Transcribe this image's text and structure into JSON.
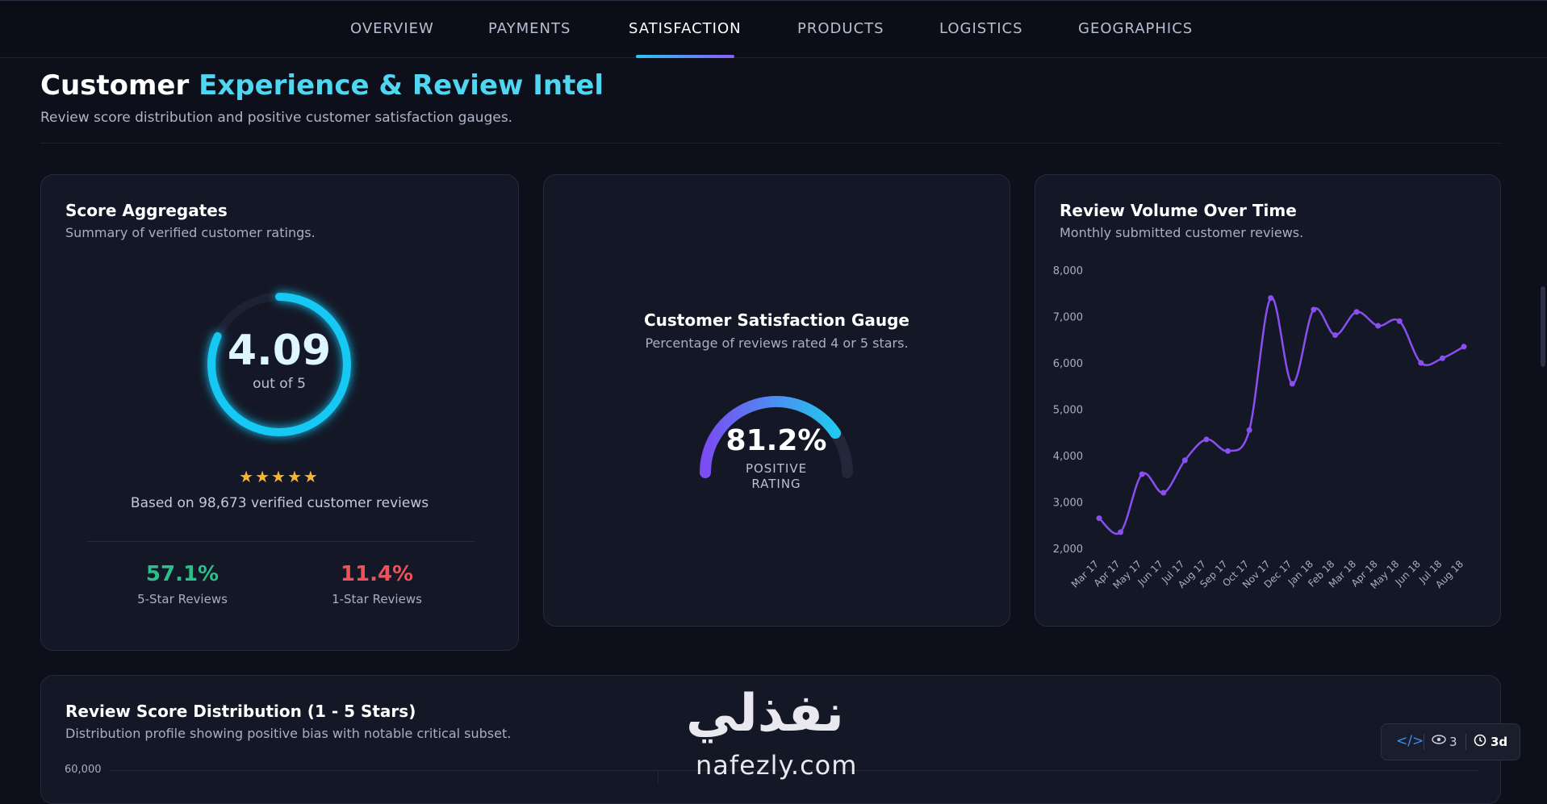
{
  "nav": {
    "tabs": [
      "OVERVIEW",
      "PAYMENTS",
      "SATISFACTION",
      "PRODUCTS",
      "LOGISTICS",
      "GEOGRAPHICS"
    ],
    "active": "SATISFACTION"
  },
  "header": {
    "title_a": "Customer ",
    "title_b": "Experience & Review Intel",
    "subtitle": "Review score distribution and positive customer satisfaction gauges."
  },
  "score_card": {
    "title": "Score Aggregates",
    "subtitle": "Summary of verified customer ratings.",
    "score": "4.09",
    "score_fraction": 0.818,
    "out_of": "out of 5",
    "stars": "★★★★★",
    "based_on": "Based on 98,673 verified customer reviews",
    "five_star_value": "57.1%",
    "five_star_label": "5-Star Reviews",
    "one_star_value": "11.4%",
    "one_star_label": "1-Star Reviews",
    "five_star_color": "#2bc08a",
    "one_star_color": "#f0505a"
  },
  "gauge_card": {
    "title": "Customer Satisfaction Gauge",
    "subtitle": "Percentage of reviews rated 4 or 5 stars.",
    "value": "81.2%",
    "fraction": 0.812,
    "label_line1": "POSITIVE",
    "label_line2": "RATING"
  },
  "volume_card": {
    "title": "Review Volume Over Time",
    "subtitle": "Monthly submitted customer reviews."
  },
  "chart_data": {
    "type": "line",
    "title": "Review Volume Over Time",
    "x": [
      "Mar 17",
      "Apr 17",
      "May 17",
      "Jun 17",
      "Jul 17",
      "Aug 17",
      "Sep 17",
      "Oct 17",
      "Nov 17",
      "Dec 17",
      "Jan 18",
      "Feb 18",
      "Mar 18",
      "Apr 18",
      "May 18",
      "Jun 18",
      "Jul 18",
      "Aug 18"
    ],
    "series": [
      {
        "values": [
          2650,
          2350,
          3600,
          3200,
          3900,
          4350,
          4100,
          4550,
          7400,
          5550,
          7150,
          6600,
          7100,
          6800,
          6900,
          6000,
          6100,
          6350
        ]
      }
    ],
    "yticks": [
      "8,000",
      "7,000",
      "6,000",
      "5,000",
      "4,000",
      "3,000",
      "2,000"
    ],
    "ylim": [
      2000,
      8000
    ],
    "color": "#8a4ff0"
  },
  "distribution_card": {
    "title": "Review Score Distribution (1 - 5 Stars)",
    "subtitle": "Distribution profile showing positive bias with notable critical subset.",
    "first_tick": "60,000"
  },
  "watermark": {
    "arabic": "نفذلي",
    "latin": "nafezly.com"
  },
  "badge": {
    "views": "3",
    "age": "3d"
  }
}
